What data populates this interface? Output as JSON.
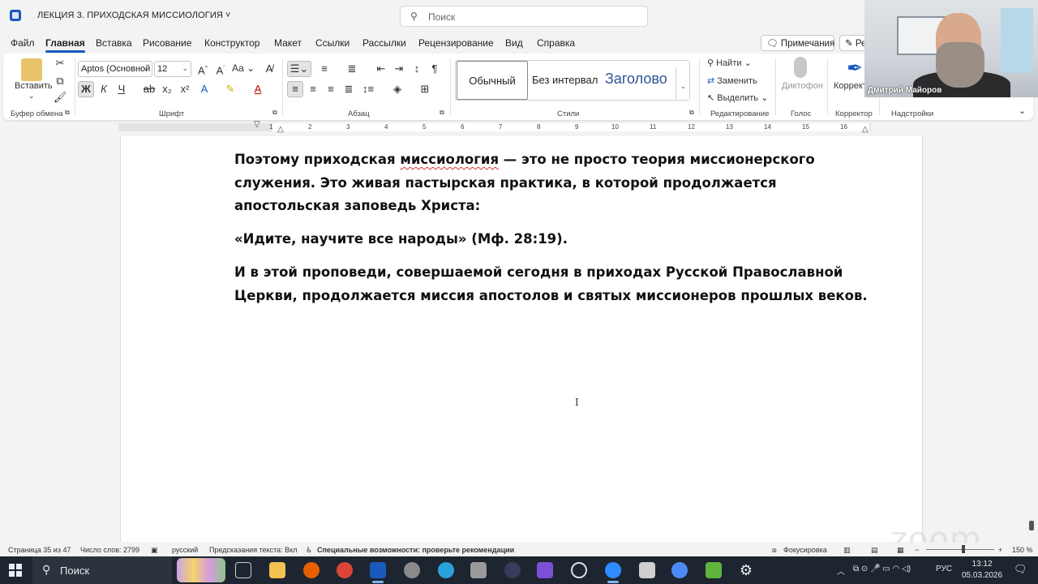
{
  "window": {
    "doc_title": "ЛЕКЦИЯ 3. ПРИХОДСКАЯ МИССИОЛОГИЯ",
    "search_placeholder": "Поиск"
  },
  "menu": {
    "tabs": [
      "Файл",
      "Главная",
      "Вставка",
      "Рисование",
      "Конструктор",
      "Макет",
      "Ссылки",
      "Рассылки",
      "Рецензирование",
      "Вид",
      "Справка"
    ],
    "active": "Главная",
    "comments_label": "Примечания",
    "edit_label": "Ре"
  },
  "ribbon": {
    "clipboard": {
      "paste_label": "Вставить",
      "group_label": "Буфер обмена"
    },
    "font": {
      "font_name": "Aptos (Основной",
      "font_size": "12",
      "case_label": "Аа",
      "group_label": "Шрифт",
      "bold": "Ж",
      "italic": "К",
      "underline": "Ч"
    },
    "paragraph": {
      "group_label": "Абзац"
    },
    "styles": {
      "items": [
        "Обычный",
        "Без интервал",
        "Заголово"
      ],
      "group_label": "Стили"
    },
    "editing": {
      "find": "Найти",
      "replace": "Заменить",
      "select": "Выделить",
      "group_label": "Редактирование"
    },
    "voice": {
      "dictate": "Диктофон",
      "group_label": "Голос"
    },
    "corrector": {
      "label": "Корректор",
      "group_label": "Корректор"
    },
    "addins": {
      "group_label": "Надстройки"
    }
  },
  "ruler": {
    "numbers": [
      "1",
      "1",
      "2",
      "3",
      "4",
      "5",
      "6",
      "7",
      "8",
      "9",
      "10",
      "11",
      "12",
      "13",
      "14",
      "15",
      "16"
    ]
  },
  "document": {
    "para1_a": "Поэтому приходская ",
    "para1_misspelled": "миссиология",
    "para1_b": " — это не просто теория миссионерского служения. Это живая пастырская практика, в которой продолжается апостольская заповедь Христа:",
    "para2": "«Идите, научите все народы» (Мф. 28:19).",
    "para3": "И в этой проповеди, совершаемой сегодня в приходах Русской Православной Церкви, продолжается миссия апостолов и святых миссионеров прошлых веков."
  },
  "statusbar": {
    "page": "Страница 35 из 47",
    "words": "Число слов: 2799",
    "language": "русский",
    "prediction": "Предсказания текста: Вкл",
    "accessibility": "Специальные возможности: проверьте рекомендации",
    "focus": "Фокусировка",
    "zoom": "150 %"
  },
  "taskbar": {
    "search_label": "Поиск",
    "lang": "РУС",
    "time": "13:12",
    "date": "05.03.2026"
  },
  "video": {
    "participant_name": "Дмитрий Майоров"
  },
  "watermark": "zoom",
  "colors": {
    "accent": "#185abd",
    "spellcheck": "#d13438",
    "taskbar": "#1d2530"
  }
}
